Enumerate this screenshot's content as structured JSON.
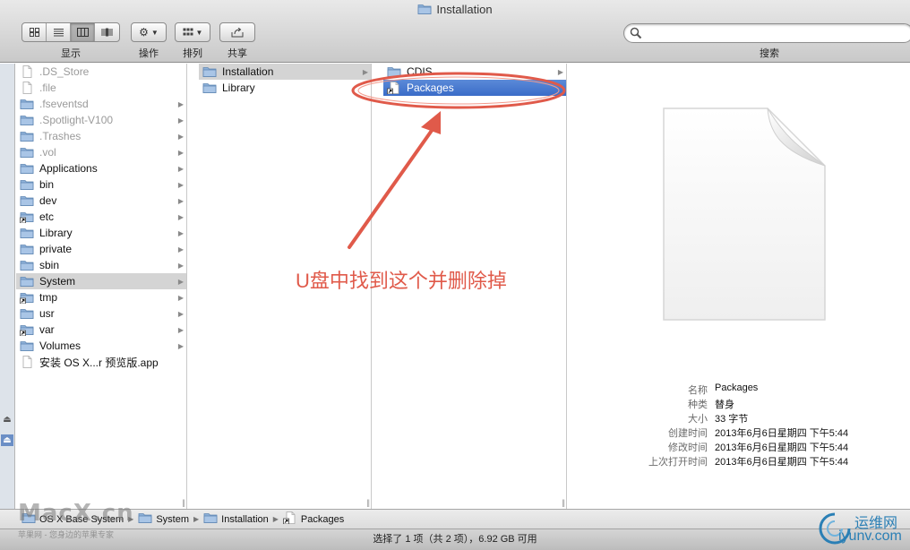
{
  "window": {
    "title": "Installation"
  },
  "toolbar": {
    "view_label": "显示",
    "action_label": "操作",
    "arrange_label": "排列",
    "share_label": "共享",
    "search_label": "搜索",
    "search_value": ""
  },
  "col1": {
    "items": [
      {
        "label": ".DS_Store"
      },
      {
        "label": ".file"
      },
      {
        "label": ".fseventsd"
      },
      {
        "label": ".Spotlight-V100"
      },
      {
        "label": ".Trashes"
      },
      {
        "label": ".vol"
      },
      {
        "label": "Applications"
      },
      {
        "label": "bin"
      },
      {
        "label": "dev"
      },
      {
        "label": "etc"
      },
      {
        "label": "Library"
      },
      {
        "label": "private"
      },
      {
        "label": "sbin"
      },
      {
        "label": "System"
      },
      {
        "label": "tmp"
      },
      {
        "label": "usr"
      },
      {
        "label": "var"
      },
      {
        "label": "Volumes"
      },
      {
        "label": "安装 OS X...r 预览版.app"
      }
    ]
  },
  "col2": {
    "items": [
      {
        "label": "Installation"
      },
      {
        "label": "Library"
      }
    ]
  },
  "col3": {
    "items": [
      {
        "label": "CDIS"
      },
      {
        "label": "Packages"
      }
    ]
  },
  "preview": {
    "fields": [
      {
        "key": "名称",
        "value": "Packages"
      },
      {
        "key": "种类",
        "value": "替身"
      },
      {
        "key": "大小",
        "value": "33 字节"
      },
      {
        "key": "创建时间",
        "value": "2013年6月6日星期四 下午5:44"
      },
      {
        "key": "修改时间",
        "value": "2013年6月6日星期四 下午5:44"
      },
      {
        "key": "上次打开时间",
        "value": "2013年6月6日星期四 下午5:44"
      }
    ]
  },
  "pathbar": {
    "crumbs": [
      "OS X Base System",
      "System",
      "Installation",
      "Packages"
    ]
  },
  "status": {
    "text": "选择了 1 项（共 2 项），6.92 GB 可用"
  },
  "annotation": {
    "text": "U盘中找到这个并删除掉",
    "color": "#e05a4a"
  },
  "watermarks": {
    "left": "MacX.cn",
    "left_sub": "苹果网 - 您身边的苹果专家",
    "right_name": "运维网",
    "right_url": "iyunv.com"
  },
  "colors": {
    "selection": "#3a6cc8",
    "folder": "#7aa3cf"
  }
}
